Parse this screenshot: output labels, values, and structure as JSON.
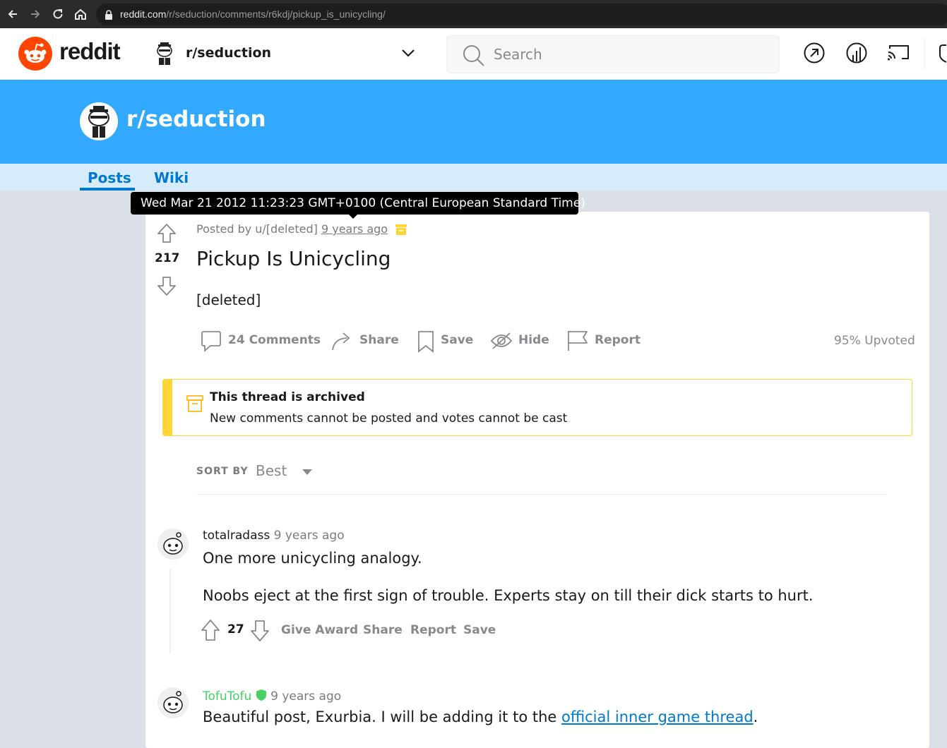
{
  "browser": {
    "url_host": "reddit.com",
    "url_path": "/r/seduction/comments/r6kdj/pickup_is_unicycling/"
  },
  "header": {
    "wordmark": "reddit",
    "community": "r/seduction",
    "search_placeholder": "Search"
  },
  "banner": {
    "title": "r/seduction"
  },
  "tabs": [
    {
      "label": "Posts"
    },
    {
      "label": "Wiki"
    }
  ],
  "tooltip": {
    "text": "Wed Mar 21 2012 11:23:23 GMT+0100 (Central European Standard Time)"
  },
  "post": {
    "score": "217",
    "posted_by": "Posted by u/[deleted]",
    "time_ago": "9 years ago",
    "title": "Pickup Is Unicycling",
    "body": "[deleted]",
    "actions": {
      "comments": "24 Comments",
      "share": "Share",
      "save": "Save",
      "hide": "Hide",
      "report": "Report"
    },
    "upvote_ratio": "95% Upvoted"
  },
  "archive": {
    "title": "This thread is archived",
    "subtitle": "New comments cannot be posted and votes cannot be cast"
  },
  "sort": {
    "label": "SORT BY",
    "value": "Best"
  },
  "comments": [
    {
      "author": "totalradass",
      "time": "9 years ago",
      "paragraphs": [
        "One more unicycling analogy.",
        "Noobs eject at the first sign of trouble. Experts stay on till their dick starts to hurt."
      ],
      "score": "27",
      "actions": {
        "give_award": "Give Award",
        "share": "Share",
        "report": "Report",
        "save": "Save"
      }
    },
    {
      "author": "TofuTofu",
      "time": "9 years ago",
      "text_before": "Beautiful post, Exurbia. I will be adding it to the ",
      "link_text": "official inner game thread",
      "text_after": "."
    }
  ],
  "colors": {
    "brand_orange": "#ff4500",
    "banner_blue": "#33a8ff",
    "link_blue": "#0079d3",
    "archive_yellow": "#ffd635",
    "mod_green": "#46d160"
  }
}
